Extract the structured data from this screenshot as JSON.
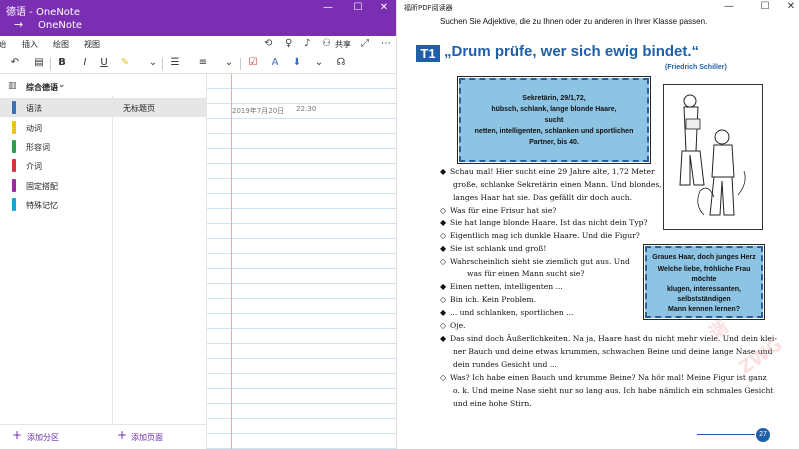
{
  "onenote": {
    "window_title": "德语 - OneNote",
    "app_name": "OneNote",
    "window_controls": {
      "minimize": "—",
      "maximize": "☐",
      "close": "✕"
    },
    "menu_tabs": [
      "始",
      "插入",
      "绘图",
      "视图"
    ],
    "share_label": "共享",
    "notebook_name": "综合德语",
    "sections": [
      {
        "label": "语法",
        "color": "#3d6fb8",
        "selected": true
      },
      {
        "label": "动词",
        "color": "#e8c51a",
        "selected": false
      },
      {
        "label": "形容词",
        "color": "#2aa04a",
        "selected": false
      },
      {
        "label": "介词",
        "color": "#d2353b",
        "selected": false
      },
      {
        "label": "固定搭配",
        "color": "#9b2a9f",
        "selected": false
      },
      {
        "label": "特殊记忆",
        "color": "#1ba2d6",
        "selected": false
      }
    ],
    "page_title": "无标题页",
    "note_date": "2019年7月20日",
    "note_time": "22:30",
    "add_section_label": "添加分区",
    "add_page_label": "添加页面"
  },
  "pdf": {
    "window_title": "福昕PDF阅读器",
    "window_controls": {
      "minimize": "—",
      "maximize": "☐",
      "close": "✕"
    },
    "instruction": "Suchen Sie Adjektive, die zu Ihnen oder zu anderen in Ihrer Klasse passen.",
    "t1_label": "T1",
    "heading": "„Drum prüfe, wer sich ewig bindet.“",
    "author": "(Friedrich Schiller)",
    "ad1_lines": [
      "Sekretärin, 29/1,72,",
      "hübsch, schlank, lange blonde Haare,",
      "sucht",
      "netten, intelligenten, schlanken und sportlichen",
      "Partner, bis 40."
    ],
    "ad2_heading": "Graues Haar, doch junges Herz",
    "ad2_lines": [
      "Welche liebe, fröhliche Frau",
      "möchte",
      "klugen, interessanten,",
      "selbstständigen",
      "Mann kennen lernen?"
    ],
    "dialog": [
      {
        "marker": "◆",
        "text": "Schau mal! Hier sucht eine 29 Jahre alte, 1,72 Meter"
      },
      {
        "marker": "",
        "text": "große, schlanke Sekretärin einen Mann. Und blondes,"
      },
      {
        "marker": "",
        "text": "langes Haar hat sie. Das gefällt dir doch auch."
      },
      {
        "marker": "◇",
        "text": "Was für eine Frisur hat sie?"
      },
      {
        "marker": "◆",
        "text": "Sie hat lange blonde Haare. Ist das nicht dein Typ?"
      },
      {
        "marker": "◇",
        "text": "Eigentlich mag ich dunkle Haare. Und die Figur?"
      },
      {
        "marker": "◆",
        "text": "Sie ist schlank und groß!"
      },
      {
        "marker": "◇",
        "text": "Wahrscheinlich sieht sie ziemlich gut aus. Und"
      },
      {
        "marker": "",
        "text": "was für einen Mann sucht sie?"
      },
      {
        "marker": "◆",
        "text": "Einen netten, intelligenten ..."
      },
      {
        "marker": "◇",
        "text": "Bin ich. Kein Problem."
      },
      {
        "marker": "◆",
        "text": "... und schlanken, sportlichen ..."
      },
      {
        "marker": "◇",
        "text": "Oje."
      },
      {
        "marker": "◆",
        "text": "Das sind doch Äußerlichkeiten. Na ja, Haare hast du nicht mehr viele. Und dein klei-"
      },
      {
        "marker": "",
        "text": "ner Bauch und deine etwas krummen, schwachen Beine und deine lange Nase und"
      },
      {
        "marker": "",
        "text": "dein rundes Gesicht und ..."
      },
      {
        "marker": "◇",
        "text": "Was? Ich habe einen Bauch und krumme Beine? Na hör mal! Meine Figur ist ganz"
      },
      {
        "marker": "",
        "text": "o. k. Und meine Nase sieht nur so lang aus. Ich habe nämlich ein schmales Gesicht"
      },
      {
        "marker": "",
        "text": "und eine hohe Stirn."
      }
    ],
    "page_number": "27"
  }
}
